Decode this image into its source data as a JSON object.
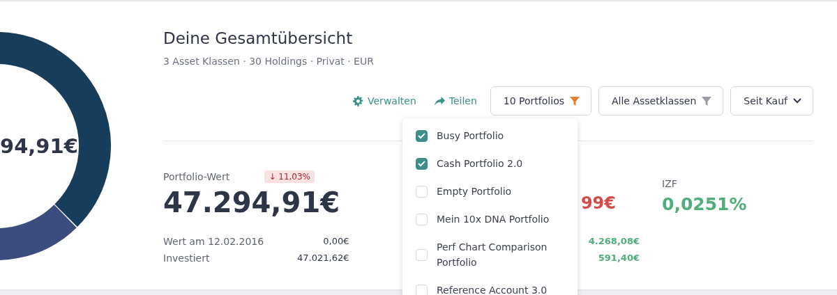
{
  "donut": {
    "center_value": "94,91€"
  },
  "header": {
    "title": "Deine Gesamtübersicht",
    "subtitle": "3 Asset Klassen · 30 Holdings · Privat · EUR"
  },
  "actions": [
    {
      "label": "Verwalten",
      "kind": "gear"
    },
    {
      "label": "Teilen",
      "kind": "share"
    }
  ],
  "filters": [
    {
      "label": "10 Portfolios",
      "kind": "filter",
      "active": true
    },
    {
      "label": "Alle Assetklassen",
      "kind": "filter",
      "active": false
    },
    {
      "label": "Seit Kauf",
      "kind": "dropdown"
    }
  ],
  "portfolio_menu": {
    "items": [
      {
        "label": "Busy Portfolio",
        "checked": true
      },
      {
        "label": "Cash Portfolio 2.0",
        "checked": true
      },
      {
        "label": "Empty Portfolio",
        "checked": false
      },
      {
        "label": "Mein 10x DNA Portfolio",
        "checked": false
      },
      {
        "label": "Perf Chart Comparison Portfolio",
        "checked": false
      },
      {
        "label": "Reference Account 3.0",
        "checked": false
      }
    ]
  },
  "stats": [
    {
      "label": "Portfolio-Wert",
      "badge": "↓ 11,03%",
      "value": "47.294,91€",
      "color": "#2e3546",
      "rows": [
        {
          "label": "Wert am 12.02.2016",
          "value": "0,00€",
          "color": "#2e3546"
        },
        {
          "label": "Investiert",
          "value": "47.021,62€",
          "color": "#2e3546"
        }
      ]
    },
    {
      "value": "99€",
      "color": "#d94a46",
      "rows": [
        {
          "value": "4.268,08€",
          "color": "#4fae7c"
        },
        {
          "value": "591,40€",
          "color": "#4fae7c"
        }
      ]
    },
    {
      "label": "IZF",
      "value": "0,0251%",
      "color": "#4fae7c"
    }
  ]
}
